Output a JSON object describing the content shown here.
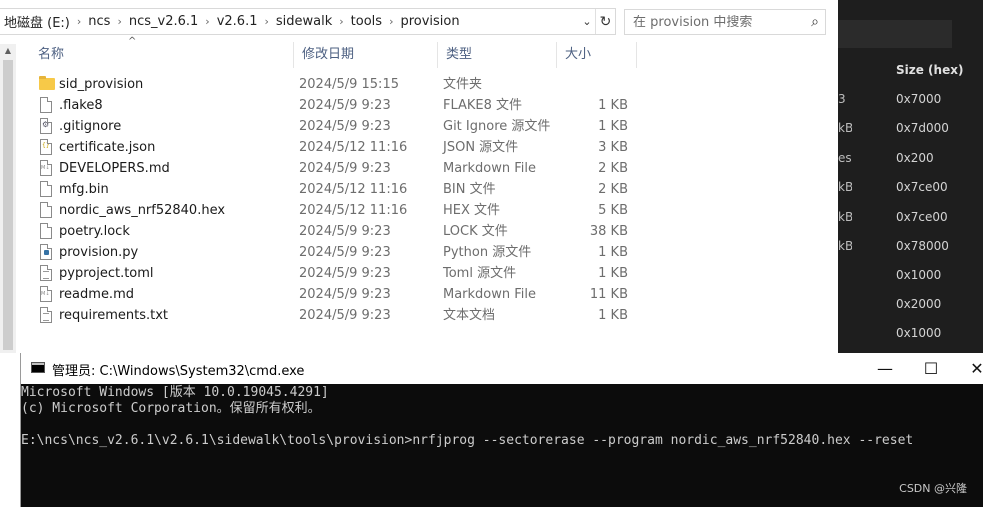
{
  "explorer": {
    "breadcrumbs": [
      "地磁盘 (E:)",
      "ncs",
      "ncs_v2.6.1",
      "v2.6.1",
      "sidewalk",
      "tools",
      "provision"
    ],
    "search_placeholder": "在 provision 中搜索",
    "columns": {
      "name": "名称",
      "date": "修改日期",
      "type": "类型",
      "size": "大小"
    },
    "files": [
      {
        "icon": "folder-icon",
        "name": "sid_provision",
        "date": "2024/5/9 15:15",
        "type": "文件夹",
        "size": ""
      },
      {
        "icon": "file-icon",
        "name": ".flake8",
        "date": "2024/5/9 9:23",
        "type": "FLAKE8 文件",
        "size": "1 KB"
      },
      {
        "icon": "gear-file-icon",
        "name": ".gitignore",
        "date": "2024/5/9 9:23",
        "type": "Git Ignore 源文件",
        "size": "1 KB"
      },
      {
        "icon": "json-file-icon",
        "name": "certificate.json",
        "date": "2024/5/12 11:16",
        "type": "JSON 源文件",
        "size": "3 KB"
      },
      {
        "icon": "markdown-file-icon",
        "name": "DEVELOPERS.md",
        "date": "2024/5/9 9:23",
        "type": "Markdown File",
        "size": "2 KB"
      },
      {
        "icon": "file-icon",
        "name": "mfg.bin",
        "date": "2024/5/12 11:16",
        "type": "BIN 文件",
        "size": "2 KB"
      },
      {
        "icon": "file-icon",
        "name": "nordic_aws_nrf52840.hex",
        "date": "2024/5/12 11:16",
        "type": "HEX 文件",
        "size": "5 KB"
      },
      {
        "icon": "file-icon",
        "name": "poetry.lock",
        "date": "2024/5/9 9:23",
        "type": "LOCK 文件",
        "size": "38 KB"
      },
      {
        "icon": "python-file-icon",
        "name": "provision.py",
        "date": "2024/5/9 9:23",
        "type": "Python 源文件",
        "size": "1 KB"
      },
      {
        "icon": "lines-file-icon",
        "name": "pyproject.toml",
        "date": "2024/5/9 9:23",
        "type": "Toml 源文件",
        "size": "1 KB"
      },
      {
        "icon": "markdown-file-icon",
        "name": "readme.md",
        "date": "2024/5/9 9:23",
        "type": "Markdown File",
        "size": "11 KB"
      },
      {
        "icon": "lines-file-icon",
        "name": "requirements.txt",
        "date": "2024/5/9 9:23",
        "type": "文本文档",
        "size": "1 KB"
      }
    ]
  },
  "background_panel": {
    "header": "Size (hex)",
    "rows": [
      {
        "left": "3",
        "value": "0x7000"
      },
      {
        "left": "kB",
        "value": "0x7d000"
      },
      {
        "left": "es",
        "value": "0x200"
      },
      {
        "left": "kB",
        "value": "0x7ce00"
      },
      {
        "left": "kB",
        "value": "0x7ce00"
      },
      {
        "left": "kB",
        "value": "0x78000"
      },
      {
        "left": "",
        "value": "0x1000"
      },
      {
        "left": "",
        "value": "0x2000"
      },
      {
        "left": "",
        "value": "0x1000"
      }
    ]
  },
  "cmd": {
    "title": "管理员: C:\\Windows\\System32\\cmd.exe",
    "lines": [
      "Microsoft Windows [版本 10.0.19045.4291]",
      "(c) Microsoft Corporation。保留所有权利。",
      "",
      "E:\\ncs\\ncs_v2.6.1\\v2.6.1\\sidewalk\\tools\\provision>nrfjprog --sectorerase --program nordic_aws_nrf52840.hex --reset"
    ],
    "minimize": "—",
    "maximize": "☐",
    "close": "✕"
  },
  "watermark": "CSDN @兴隆"
}
